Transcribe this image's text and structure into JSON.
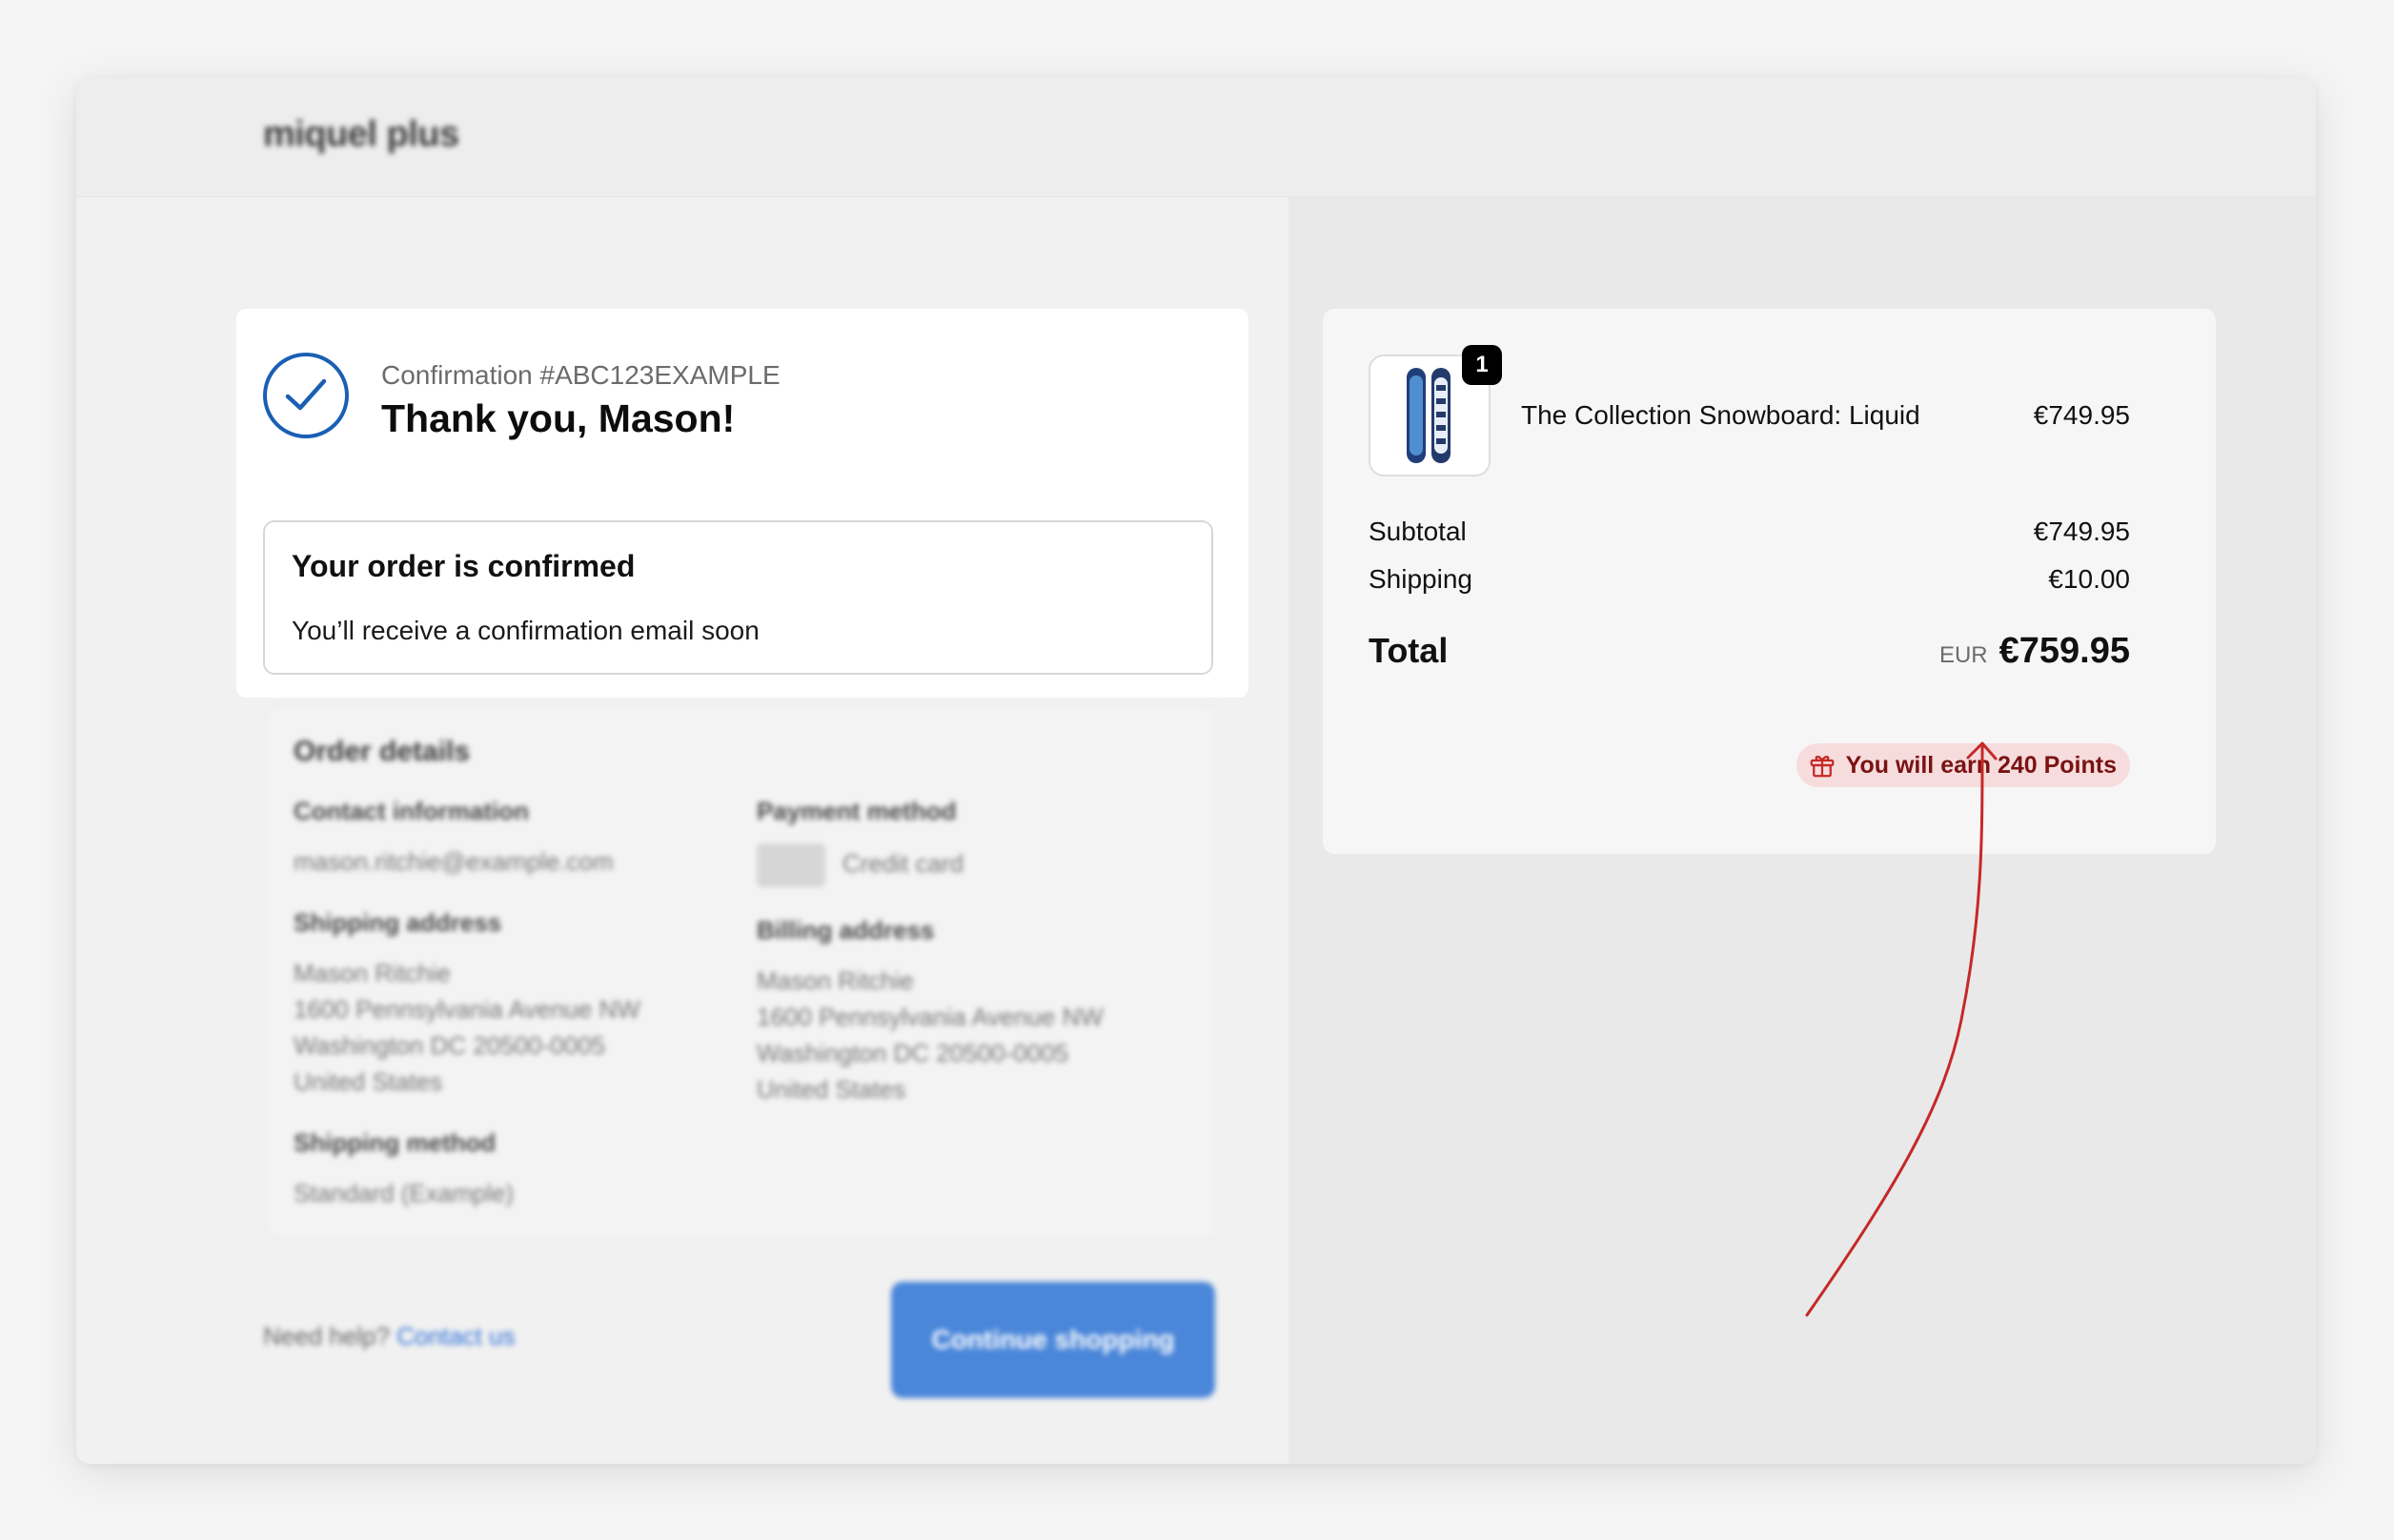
{
  "header": {
    "brand": "miquel plus"
  },
  "confirmation": {
    "number": "Confirmation #ABC123EXAMPLE",
    "thanks": "Thank you, Mason!",
    "status_title": "Your order is confirmed",
    "status_text": "You’ll receive a confirmation email soon"
  },
  "order_details": {
    "title": "Order details",
    "contact_heading": "Contact information",
    "email": "mason.ritchie@example.com",
    "shipping_address_heading": "Shipping address",
    "shipping_address": [
      "Mason Ritchie",
      "1600 Pennsylvania Avenue NW",
      "Washington DC 20500-0005",
      "United States"
    ],
    "shipping_method_heading": "Shipping method",
    "shipping_method": "Standard (Example)",
    "payment_heading": "Payment method",
    "payment_method": "Credit card",
    "billing_address_heading": "Billing address",
    "billing_address": [
      "Mason Ritchie",
      "1600 Pennsylvania Avenue NW",
      "Washington DC 20500-0005",
      "United States"
    ]
  },
  "footer": {
    "help_text": "Need help?",
    "contact_link": "Contact us",
    "continue_button": "Continue shopping"
  },
  "summary": {
    "item": {
      "name": "The Collection Snowboard: Liquid",
      "price": "€749.95",
      "quantity": "1"
    },
    "subtotal_label": "Subtotal",
    "subtotal_value": "€749.95",
    "shipping_label": "Shipping",
    "shipping_value": "€10.00",
    "total_label": "Total",
    "currency": "EUR",
    "total_value": "€759.95",
    "points_text": "You will earn 240 Points"
  },
  "colors": {
    "accent_blue": "#1a5fb4",
    "button_blue": "#4a86d9",
    "points_bg": "#f6dcdc",
    "points_text": "#7a1212",
    "annotation_arrow": "#c62828"
  }
}
